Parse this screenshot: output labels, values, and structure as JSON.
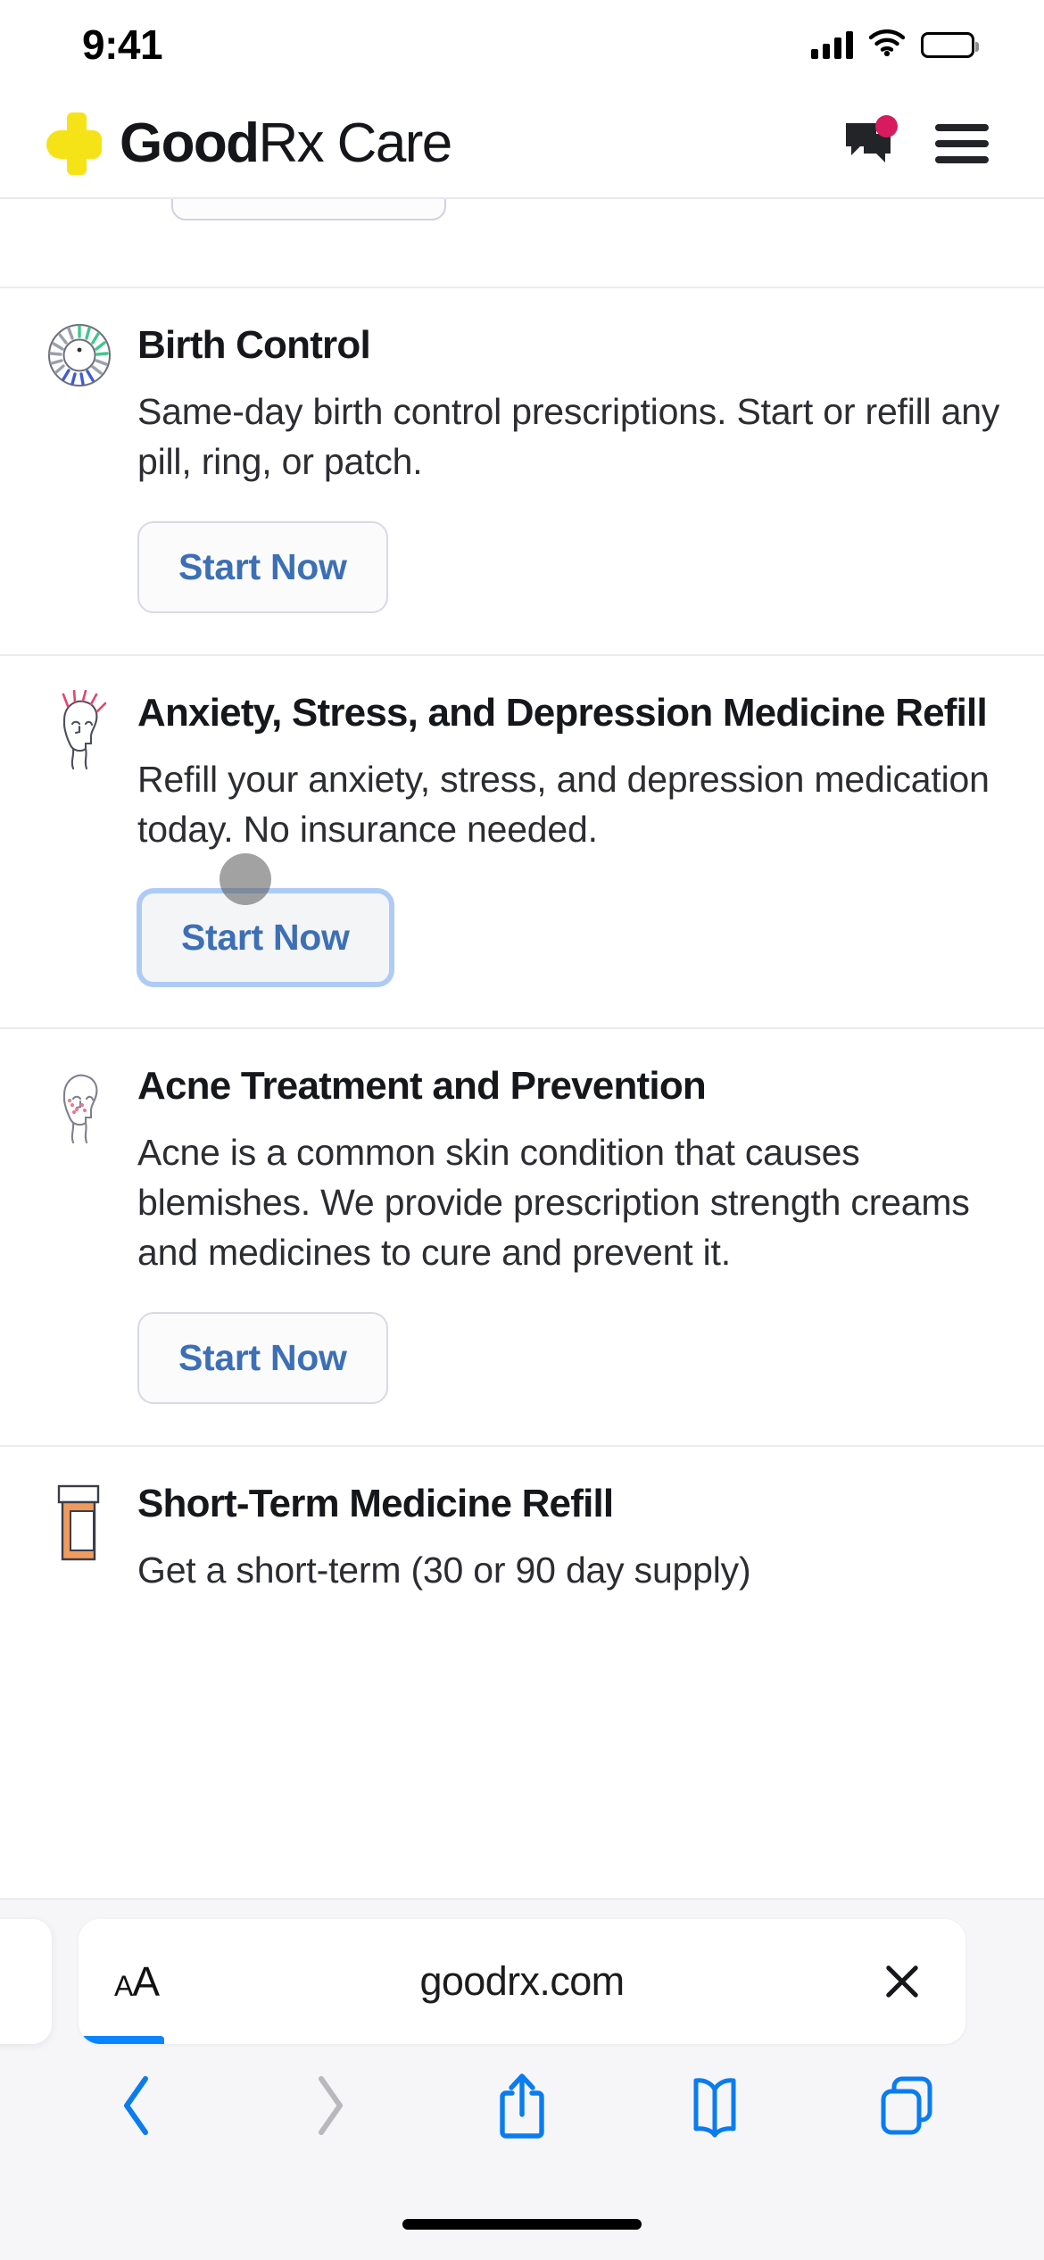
{
  "status_bar": {
    "time": "9:41",
    "signal_icon": "cellular-signal-icon",
    "wifi_icon": "wifi-icon",
    "battery_icon": "battery-full-icon"
  },
  "header": {
    "logo_icon": "goodrx-cross-logo-icon",
    "brand_part1": "Good",
    "brand_part2": "Rx",
    "brand_part3": " Care",
    "chat_icon": "chat-bubble-icon",
    "chat_badge": "notification-dot",
    "menu_icon": "hamburger-menu-icon",
    "accent_yellow": "#f5e317",
    "badge_color": "#d81b5e"
  },
  "services": [
    {
      "icon": "birth-control-pill-dial-icon",
      "title": "Birth Control",
      "description": "Same-day birth control prescriptions. Start or refill any pill, ring, or patch.",
      "button_label": "Start Now",
      "focused": false
    },
    {
      "icon": "stressed-head-icon",
      "title": "Anxiety, Stress, and Depression Medicine Refill",
      "description": "Refill your anxiety, stress, and depression medication today. No insurance needed.",
      "button_label": "Start Now",
      "focused": true
    },
    {
      "icon": "acne-face-icon",
      "title": "Acne Treatment and Prevention",
      "description": "Acne is a common skin condition that causes blemishes. We provide prescription strength creams and medicines to cure and prevent it.",
      "button_label": "Start Now",
      "focused": false
    },
    {
      "icon": "pill-bottle-icon",
      "title": "Short-Term Medicine Refill",
      "description": "Get a short-term (30 or 90 day supply)",
      "button_label": "",
      "focused": false
    }
  ],
  "browser": {
    "text_size_label_small": "A",
    "text_size_label_large": "A",
    "text_size_icon": "text-size-icon",
    "url": "goodrx.com",
    "stop_icon": "stop-loading-icon",
    "progress_color": "#0a84ff",
    "toolbar": {
      "back_icon": "back-chevron-icon",
      "forward_icon": "forward-chevron-icon",
      "share_icon": "share-icon",
      "bookmarks_icon": "bookmarks-book-icon",
      "tabs_icon": "tabs-icon",
      "active_color": "#0a7cf0",
      "disabled_color": "#b8b8bd"
    }
  },
  "button_text_color": "#3d6fb5"
}
